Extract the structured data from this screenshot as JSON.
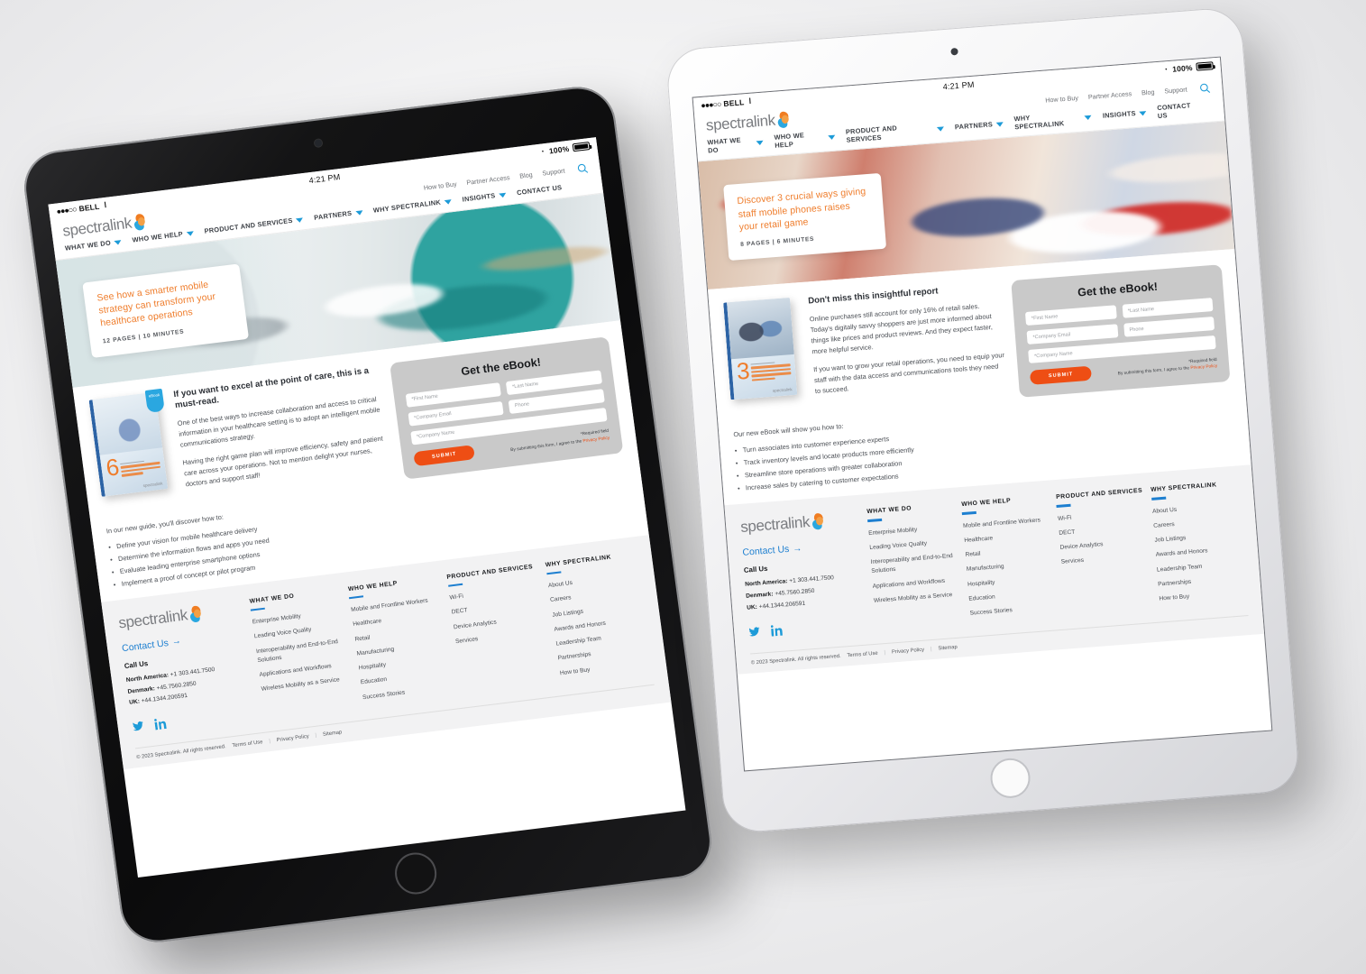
{
  "scene": {
    "background_color": "#f0f0f1",
    "devices": [
      {
        "name": "left-tablet",
        "frame_color": "#0e0e10",
        "frame_finish": "space-gray"
      },
      {
        "name": "right-tablet",
        "frame_color": "#f2f2f4",
        "frame_finish": "silver"
      }
    ]
  },
  "status_bar": {
    "carrier": "BELL",
    "signal_dots": "●●●○○",
    "wifi_icon": "wifi-icon",
    "time": "4:21 PM",
    "bluetooth_icon": "bluetooth-icon",
    "battery_percent": "100%",
    "battery_icon": "battery-full-icon"
  },
  "site": {
    "logo_text": "spectralink",
    "logo_mark": "spectralink-s-logo",
    "top_links": [
      "How to Buy",
      "Partner Access",
      "Blog",
      "Support"
    ],
    "search_icon": "search-icon",
    "main_nav": [
      {
        "label": "WHAT WE DO",
        "has_caret": true
      },
      {
        "label": "WHO WE HELP",
        "has_caret": true
      },
      {
        "label": "PRODUCT AND SERVICES",
        "has_caret": true
      },
      {
        "label": "PARTNERS",
        "has_caret": true
      },
      {
        "label": "WHY SPECTRALINK",
        "has_caret": true
      },
      {
        "label": "INSIGHTS",
        "has_caret": true
      },
      {
        "label": "CONTACT US",
        "has_caret": false
      }
    ]
  },
  "pages": {
    "healthcare": {
      "hero": {
        "image": "doctors-and-nurse-in-hospital-corridor",
        "headline": "See how a smarter mobile strategy can transform your healthcare operations",
        "meta": "12 PAGES | 10 MINUTES"
      },
      "ebook_cover": {
        "image": "clinician-walking-in-hospital-hallway",
        "number": "6",
        "eyebrow": "Six Steps to Developing a",
        "title": "Successful Clinical Mobile Communications Strategy",
        "badge": "eBook",
        "logo": "spectralink"
      },
      "body": {
        "heading": "If you want to excel at the point of care, this is a must-read.",
        "paragraphs": [
          "One of the best ways to increase collaboration and access to critical information in your healthcare setting is to adopt an intelligent mobile communications strategy.",
          "Having the right game plan will improve efficiency, safety and patient care across your operations. Not to mention delight your nurses, doctors and support staff!"
        ],
        "list_intro": "In our new guide, you'll discover how to:",
        "list_items": [
          "Define your vision for mobile healthcare delivery",
          "Determine the information flows and apps you need",
          "Evaluate leading enterprise smartphone options",
          "Implement a proof of concept or pilot program"
        ]
      }
    },
    "retail": {
      "hero": {
        "image": "shopper-holding-shopping-bags",
        "headline": "Discover 3 crucial ways giving staff mobile phones raises your retail game",
        "meta": "8 PAGES | 6 MINUTES"
      },
      "ebook_cover": {
        "image": "two-women-shopping-in-store",
        "number": "3",
        "eyebrow": "Ways to",
        "title": "Leverage Mobile Communications To Meet the Needs of Digitally Savvy Shoppers",
        "badge": "",
        "logo": "spectralink"
      },
      "body": {
        "heading": "Don't miss this insightful report",
        "paragraphs": [
          "Online purchases still account for only 16% of retail sales. Today's digitally savvy shoppers are just more informed about things like prices and product reviews. And they expect faster, more helpful service.",
          "If you want to grow your retail operations, you need to equip your staff with the data access and communications tools they need to succeed."
        ],
        "list_intro": "Our new eBook will show you how to:",
        "list_items": [
          "Turn associates into customer experience experts",
          "Track inventory levels and locate products more efficiently",
          "Streamline store operations with greater collaboration",
          "Increase sales by catering to customer expectations"
        ]
      }
    }
  },
  "form": {
    "title": "Get the eBook!",
    "fields": [
      {
        "name": "first-name",
        "placeholder": "*First Name"
      },
      {
        "name": "last-name",
        "placeholder": "*Last Name"
      },
      {
        "name": "company-email",
        "placeholder": "*Company Email"
      },
      {
        "name": "phone",
        "placeholder": "Phone"
      },
      {
        "name": "company-name",
        "placeholder": "*Company Name"
      }
    ],
    "submit_label": "SUBMIT",
    "required_note": "*Required field",
    "consent_prefix": "By submitting this form, I agree to the ",
    "consent_link": "Privacy Policy",
    "accent_color": "#ee4e14",
    "card_color": "#c9c9c9"
  },
  "footer": {
    "logo_text": "spectralink",
    "contact_label": "Contact Us",
    "contact_arrow": "→",
    "call_us_label": "Call Us",
    "phones": [
      {
        "region": "North America:",
        "number": "+1 303.441.7500"
      },
      {
        "region": "Denmark:",
        "number": "+45.7560.2850"
      },
      {
        "region": "UK:",
        "number": "+44.1344.206591"
      }
    ],
    "social": [
      {
        "name": "twitter-icon"
      },
      {
        "name": "linkedin-icon"
      }
    ],
    "columns": [
      {
        "heading": "WHAT WE DO",
        "links": [
          "Enterprise Mobility",
          "Leading Voice Quality",
          "Interoperability and End-to-End Solutions",
          "Applications and Workflows",
          "Wireless Mobility as a Service"
        ]
      },
      {
        "heading": "WHO WE HELP",
        "links": [
          "Mobile and Frontline Workers",
          "Healthcare",
          "Retail",
          "Manufacturing",
          "Hospitality",
          "Education",
          "Success Stories"
        ]
      },
      {
        "heading": "PRODUCT AND SERVICES",
        "links": [
          "Wi-Fi",
          "DECT",
          "Device Analytics",
          "Services"
        ]
      },
      {
        "heading": "WHY SPECTRALINK",
        "links": [
          "About Us",
          "Careers",
          "Job Listings",
          "Awards and Honors",
          "Leadership Team",
          "Partnerships",
          "How to Buy"
        ]
      }
    ],
    "copyright": "© 2023 Spectralink. All rights reserved.",
    "legal_links": [
      "Terms of Use",
      "Privacy Policy",
      "Sitemap"
    ],
    "accent_color": "#1d7fd0"
  }
}
